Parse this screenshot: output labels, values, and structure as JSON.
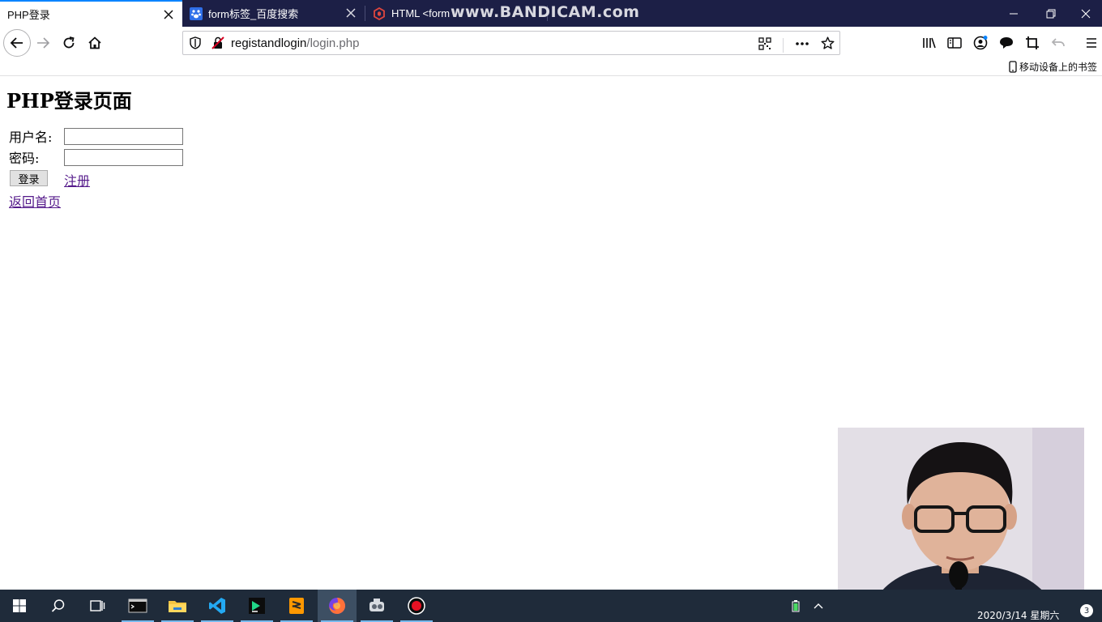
{
  "browser": {
    "tabs": [
      {
        "title": "PHP登录",
        "active": true,
        "icon": "blank-page-icon"
      },
      {
        "title": "form标签_百度搜索",
        "active": false,
        "icon": "baidu-paw-icon"
      },
      {
        "title": "HTML <form",
        "active": false,
        "icon": "tutorial-site-icon"
      }
    ],
    "overlay_watermark": "www.BANDICAM.com",
    "url": {
      "host": "registandlogin",
      "path": "/login.php"
    },
    "bookmarks_mobile_label": "移动设备上的书签"
  },
  "page": {
    "heading": "PHP登录页面",
    "username_label": "用户名:",
    "password_label": "密码:",
    "username_value": "",
    "password_value": "",
    "login_button": "登录",
    "register_link": "注册",
    "home_link": "返回首页"
  },
  "taskbar": {
    "apps": [
      "start-icon",
      "search-icon",
      "task-view-icon",
      "terminal-icon",
      "file-explorer-icon",
      "vscode-icon",
      "pycharm-icon",
      "sublime-icon",
      "firefox-icon",
      "tool-icon",
      "record-icon"
    ],
    "clock": "2020/3/14 星期六",
    "notification_count": "3"
  },
  "colors": {
    "tabbar_bg": "#1c1f46",
    "active_tab_accent": "#0a84ff",
    "link_visited": "#551a8b",
    "taskbar_bg": "#1f2b3a"
  }
}
